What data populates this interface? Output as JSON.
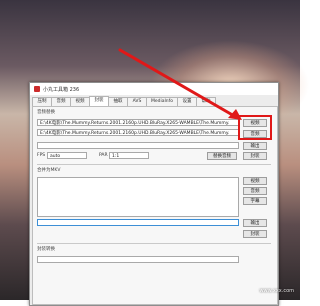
{
  "window": {
    "title": "小丸工具箱 236"
  },
  "tabs": [
    {
      "label": "压制"
    },
    {
      "label": "音频"
    },
    {
      "label": "视频"
    },
    {
      "label": "封装"
    },
    {
      "label": "抽取"
    },
    {
      "label": "AVS"
    },
    {
      "label": "MediaInfo"
    },
    {
      "label": "设置"
    },
    {
      "label": "帮助"
    }
  ],
  "sections": {
    "mux": {
      "label": "音频替换",
      "video_path": "E:\\4K电影\\The.Mummy.Returns.2001.2160p.UHD.BluRay.X265-WAMBLE\\The.Mummy.",
      "audio_path": "E:\\4K电影\\The.Mummy.Returns.2001.2160p.UHD.BluRay.X265-WAMBLE\\The.Mummy.",
      "output_path": "",
      "fps_label": "FPS",
      "fps_value": "auto",
      "par_label": "PAR",
      "par_value": "1:1",
      "buttons": {
        "video": "视频",
        "audio": "音频",
        "output": "输出",
        "replace_audio": "替换音频",
        "mux": "封装"
      }
    },
    "mux_mkv": {
      "label": "合并为MKV",
      "buttons": {
        "video": "视频",
        "audio": "音频",
        "subtitle": "字幕",
        "output": "输出",
        "mux": "封装"
      }
    },
    "convert": {
      "label": "封装转换"
    }
  },
  "watermark": "www.xxx.com",
  "colors": {
    "highlight": "#e01818"
  }
}
